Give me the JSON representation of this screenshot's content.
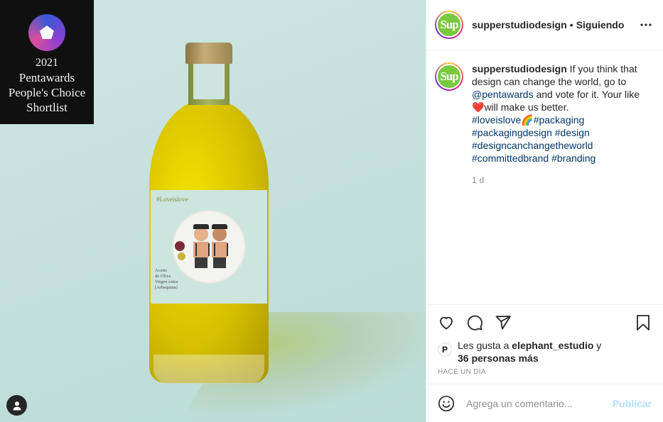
{
  "post": {
    "username": "supperstudiodesign",
    "separator": "•",
    "follow_status": "Siguiendo",
    "avatar_text": "Sup"
  },
  "image": {
    "badge_year": "2021",
    "badge_line1": "Pentawards",
    "badge_line2": "People's Choice",
    "badge_line3": "Shortlist",
    "bottle_tag": "#Loveislove",
    "bottle_text_1": "Aceite",
    "bottle_text_2": "de Oliva",
    "bottle_text_3": "Virgen extra",
    "bottle_text_4": "[Arbequina]"
  },
  "caption": {
    "username": "supperstudiodesign",
    "text_1": " If you think that design can change the world, go to ",
    "mention": "@pentawards",
    "text_2": " and vote for it. Your like ",
    "heart_emoji": "❤️",
    "text_3": "will make us better.",
    "hashtags": [
      "#loveislove",
      "🌈",
      "#packaging",
      "#packagingdesign",
      "#design",
      "#designcanchangetheworld",
      "#committedbrand",
      "#branding"
    ],
    "time": "1 d"
  },
  "likes": {
    "prefix": "Les gusta a ",
    "user": "elephant_estudio",
    "conj": " y",
    "others": "36 personas más",
    "liker_avatar_text": "P"
  },
  "timestamp": "HACE UN DÍA",
  "comment": {
    "placeholder": "Agrega un comentario...",
    "post_label": "Publicar"
  },
  "icons": {
    "like": "heart-icon",
    "comment": "comment-icon",
    "share": "paper-plane-icon",
    "save": "bookmark-icon",
    "more": "more-dots-icon",
    "emoji": "smiley-icon",
    "tag": "user-tag-icon"
  },
  "colors": {
    "link": "#00376b",
    "muted": "#8e8e8e",
    "publish_disabled": "#b2dffc",
    "brand_green": "#79c93c"
  }
}
